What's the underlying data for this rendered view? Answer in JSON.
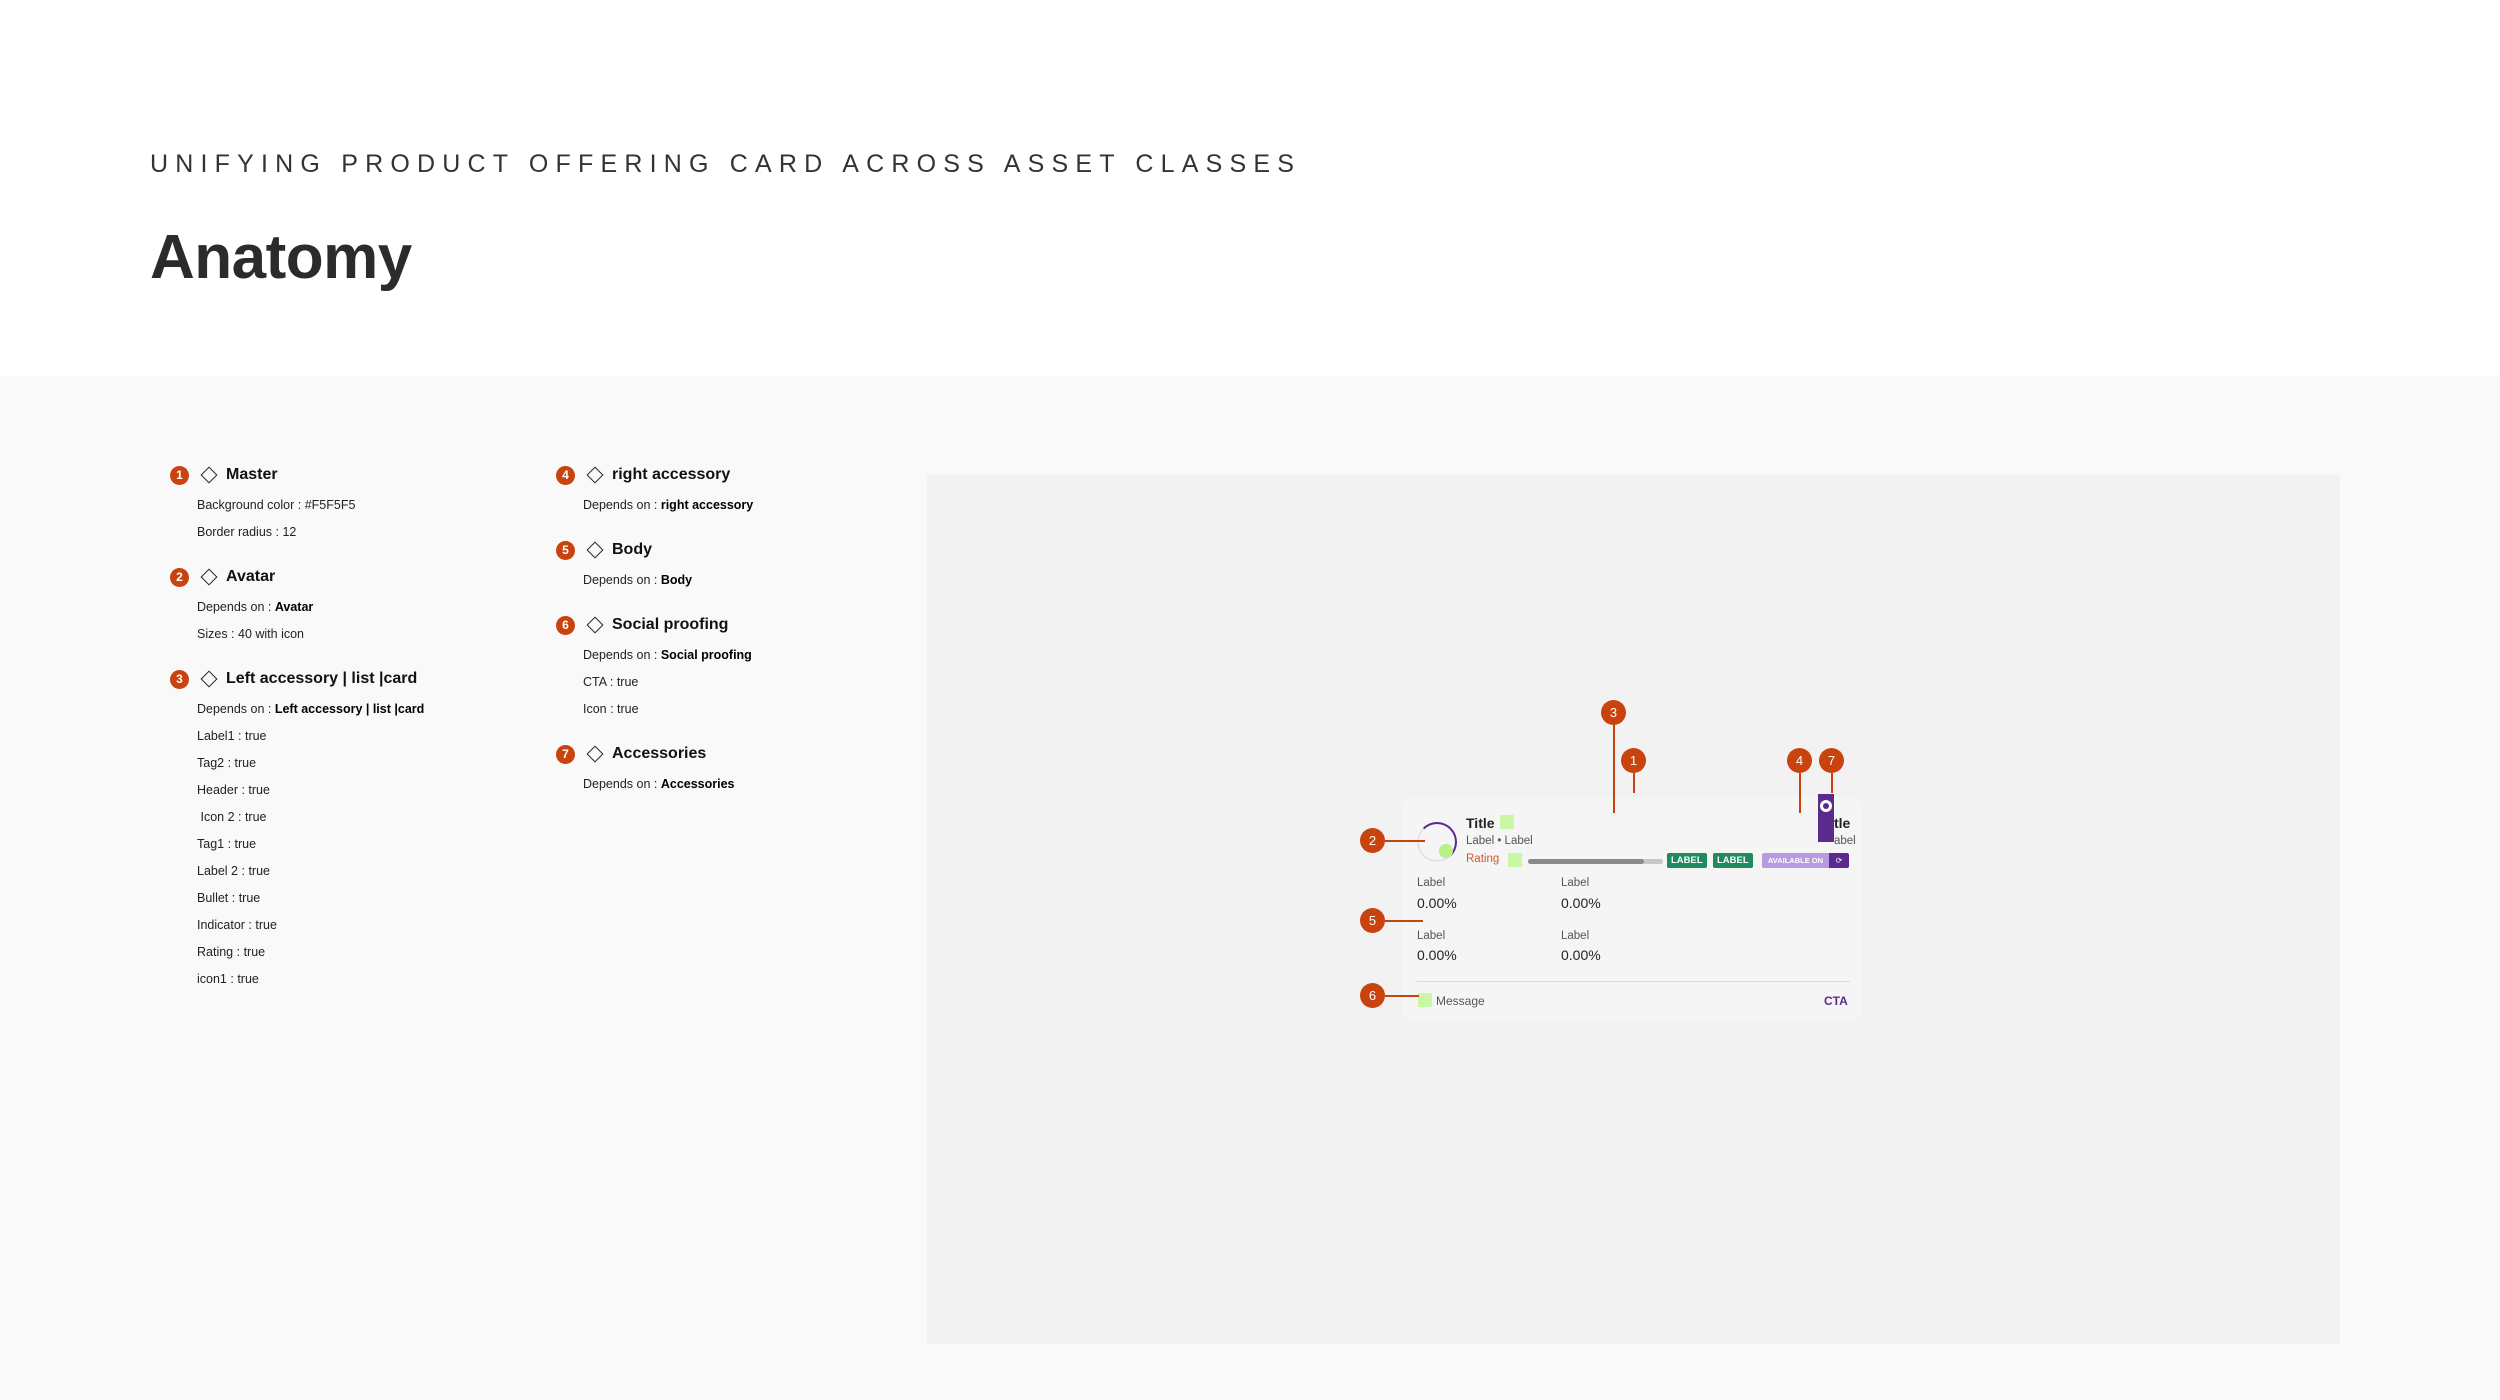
{
  "header": {
    "eyebrow": "UNIFYING PRODUCT OFFERING CARD ACROSS ASSET CLASSES",
    "title": "Anatomy"
  },
  "specs": [
    {
      "num": "1",
      "title": "Master",
      "props": [
        {
          "k": "Background color : ",
          "v": "#F5F5F5",
          "bold": false
        },
        {
          "k": "Border radius : ",
          "v": "12",
          "bold": false
        }
      ]
    },
    {
      "num": "2",
      "title": "Avatar",
      "props": [
        {
          "k": "Depends on : ",
          "v": "Avatar",
          "bold": true
        },
        {
          "k": "Sizes : ",
          "v": "40 with icon",
          "bold": false
        }
      ]
    },
    {
      "num": "3",
      "title": "Left accessory | list |card",
      "props": [
        {
          "k": "Depends on : ",
          "v": "Left accessory | list |card",
          "bold": true
        },
        {
          "k": "Label1 : ",
          "v": "true",
          "bold": false
        },
        {
          "k": "Tag2 : ",
          "v": "true",
          "bold": false
        },
        {
          "k": "Header : ",
          "v": "true",
          "bold": false
        },
        {
          "k": " Icon 2 : ",
          "v": "true",
          "bold": false
        },
        {
          "k": "Tag1 : ",
          "v": "true",
          "bold": false
        },
        {
          "k": "Label 2 : ",
          "v": "true",
          "bold": false
        },
        {
          "k": "Bullet : ",
          "v": "true",
          "bold": false
        },
        {
          "k": "Indicator : ",
          "v": "true",
          "bold": false
        },
        {
          "k": "Rating : ",
          "v": "true",
          "bold": false
        },
        {
          "k": "icon1 : ",
          "v": "true",
          "bold": false
        }
      ]
    },
    {
      "num": "4",
      "title": "right accessory",
      "props": [
        {
          "k": "Depends on : ",
          "v": "right accessory",
          "bold": true
        }
      ]
    },
    {
      "num": "5",
      "title": "Body",
      "props": [
        {
          "k": "Depends on : ",
          "v": "Body",
          "bold": true
        }
      ]
    },
    {
      "num": "6",
      "title": "Social proofing",
      "props": [
        {
          "k": "Depends on : ",
          "v": "Social proofing",
          "bold": true
        },
        {
          "k": "CTA : ",
          "v": "true",
          "bold": false
        },
        {
          "k": "Icon : ",
          "v": "true",
          "bold": false
        }
      ]
    },
    {
      "num": "7",
      "title": "Accessories",
      "props": [
        {
          "k": "Depends on : ",
          "v": "Accessories",
          "bold": true
        }
      ]
    }
  ],
  "card": {
    "title": "Title",
    "sublabel": "Label • Label",
    "rating": "Rating",
    "rating_fraction": 0.86,
    "tags": [
      "LABEL",
      "LABEL"
    ],
    "available": "AVAILABLE ON",
    "available_logo": "⟳",
    "right_title": "tle",
    "right_label": "abel",
    "metrics": [
      {
        "label": "Label",
        "value": "0.00%"
      },
      {
        "label": "Label",
        "value": "0.00%"
      },
      {
        "label": "Label",
        "value": "0.00%"
      },
      {
        "label": "Label",
        "value": "0.00%"
      }
    ],
    "message": "Message",
    "cta": "CTA"
  },
  "callouts": [
    "1",
    "2",
    "3",
    "4",
    "5",
    "6",
    "7"
  ],
  "colors": {
    "accent": "#C9430E",
    "brand_purple": "#5B2A8C",
    "card_bg": "#F5F5F5",
    "tag_green": "#1E8A5E",
    "placeholder_green": "#C9F7A4"
  }
}
